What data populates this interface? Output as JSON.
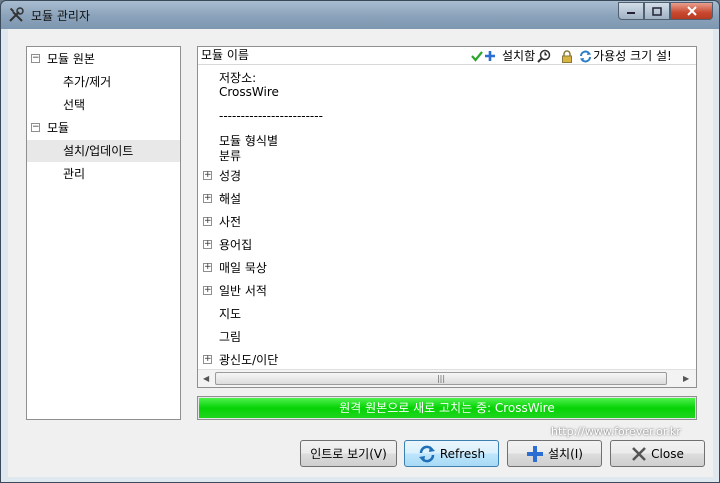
{
  "window": {
    "title": "모듈 관리자",
    "buttons": [
      "min",
      "max",
      "close"
    ]
  },
  "tree": {
    "items": [
      {
        "label": "모듈 원본",
        "expanded": true,
        "level": 0
      },
      {
        "label": "추가/제거",
        "level": 1
      },
      {
        "label": "선택",
        "level": 1
      },
      {
        "label": "모듈",
        "expanded": true,
        "level": 0
      },
      {
        "label": "설치/업데이트",
        "level": 1,
        "selected": true
      },
      {
        "label": "관리",
        "level": 1
      }
    ]
  },
  "content": {
    "header": {
      "name_col": "모듈 이름",
      "installed_col": "설치함",
      "available_col": "가용성 크기 설!"
    },
    "source_label": "저장소:",
    "source_name": "CrossWire",
    "separator": "------------------------",
    "group_label_1": "모듈 형식별",
    "group_label_2": "분류",
    "categories": [
      {
        "label": "성경",
        "expandable": true
      },
      {
        "label": "해설",
        "expandable": true
      },
      {
        "label": "사전",
        "expandable": true
      },
      {
        "label": "용어집",
        "expandable": true
      },
      {
        "label": "매일 묵상",
        "expandable": true
      },
      {
        "label": "일반 서적",
        "expandable": true
      },
      {
        "label": "지도",
        "expandable": false
      },
      {
        "label": "그림",
        "expandable": false
      },
      {
        "label": "광신도/이단",
        "expandable": true
      }
    ]
  },
  "progress": {
    "text": "원격 원본으로 새로 고치는 중: CrossWire",
    "fraction": 1.0,
    "color": "#06d306"
  },
  "buttons": {
    "intro": "인트로 보기(V)",
    "refresh": "Refresh",
    "install": "설치(I)",
    "close": "Close"
  },
  "watermark": "http://www.forever.or.kr",
  "icons": [
    "tools-icon",
    "check-icon",
    "plus-icon",
    "magnifier-icon",
    "lock-icon",
    "refresh-icon",
    "close-x-icon"
  ]
}
